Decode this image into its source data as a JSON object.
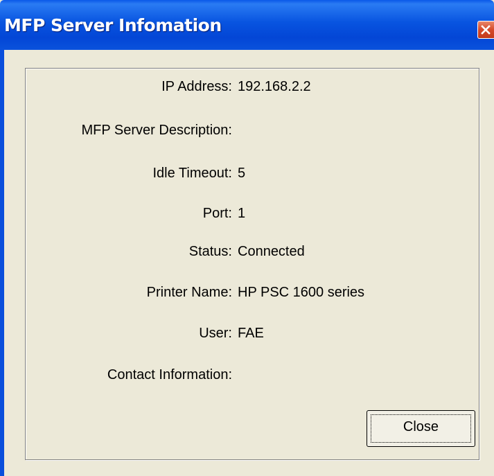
{
  "window": {
    "title": "MFP Server Infomation"
  },
  "fields": [
    {
      "label": "IP Address:",
      "value": "192.168.2.2"
    },
    {
      "label": "MFP Server Description:",
      "value": ""
    },
    {
      "label": "Idle Timeout:",
      "value": "5"
    },
    {
      "label": "Port:",
      "value": "1"
    },
    {
      "label": "Status:",
      "value": "Connected"
    },
    {
      "label": "Printer Name:",
      "value": "HP PSC 1600 series"
    },
    {
      "label": "User:",
      "value": "FAE"
    },
    {
      "label": "Contact Information:",
      "value": ""
    }
  ],
  "buttons": {
    "close_label": "Close"
  },
  "colors": {
    "title_bar": "#0854e0",
    "dialog_background": "#ece9d8",
    "close_icon_red": "#d5492a"
  },
  "icons": {
    "title_close": "close-icon"
  }
}
